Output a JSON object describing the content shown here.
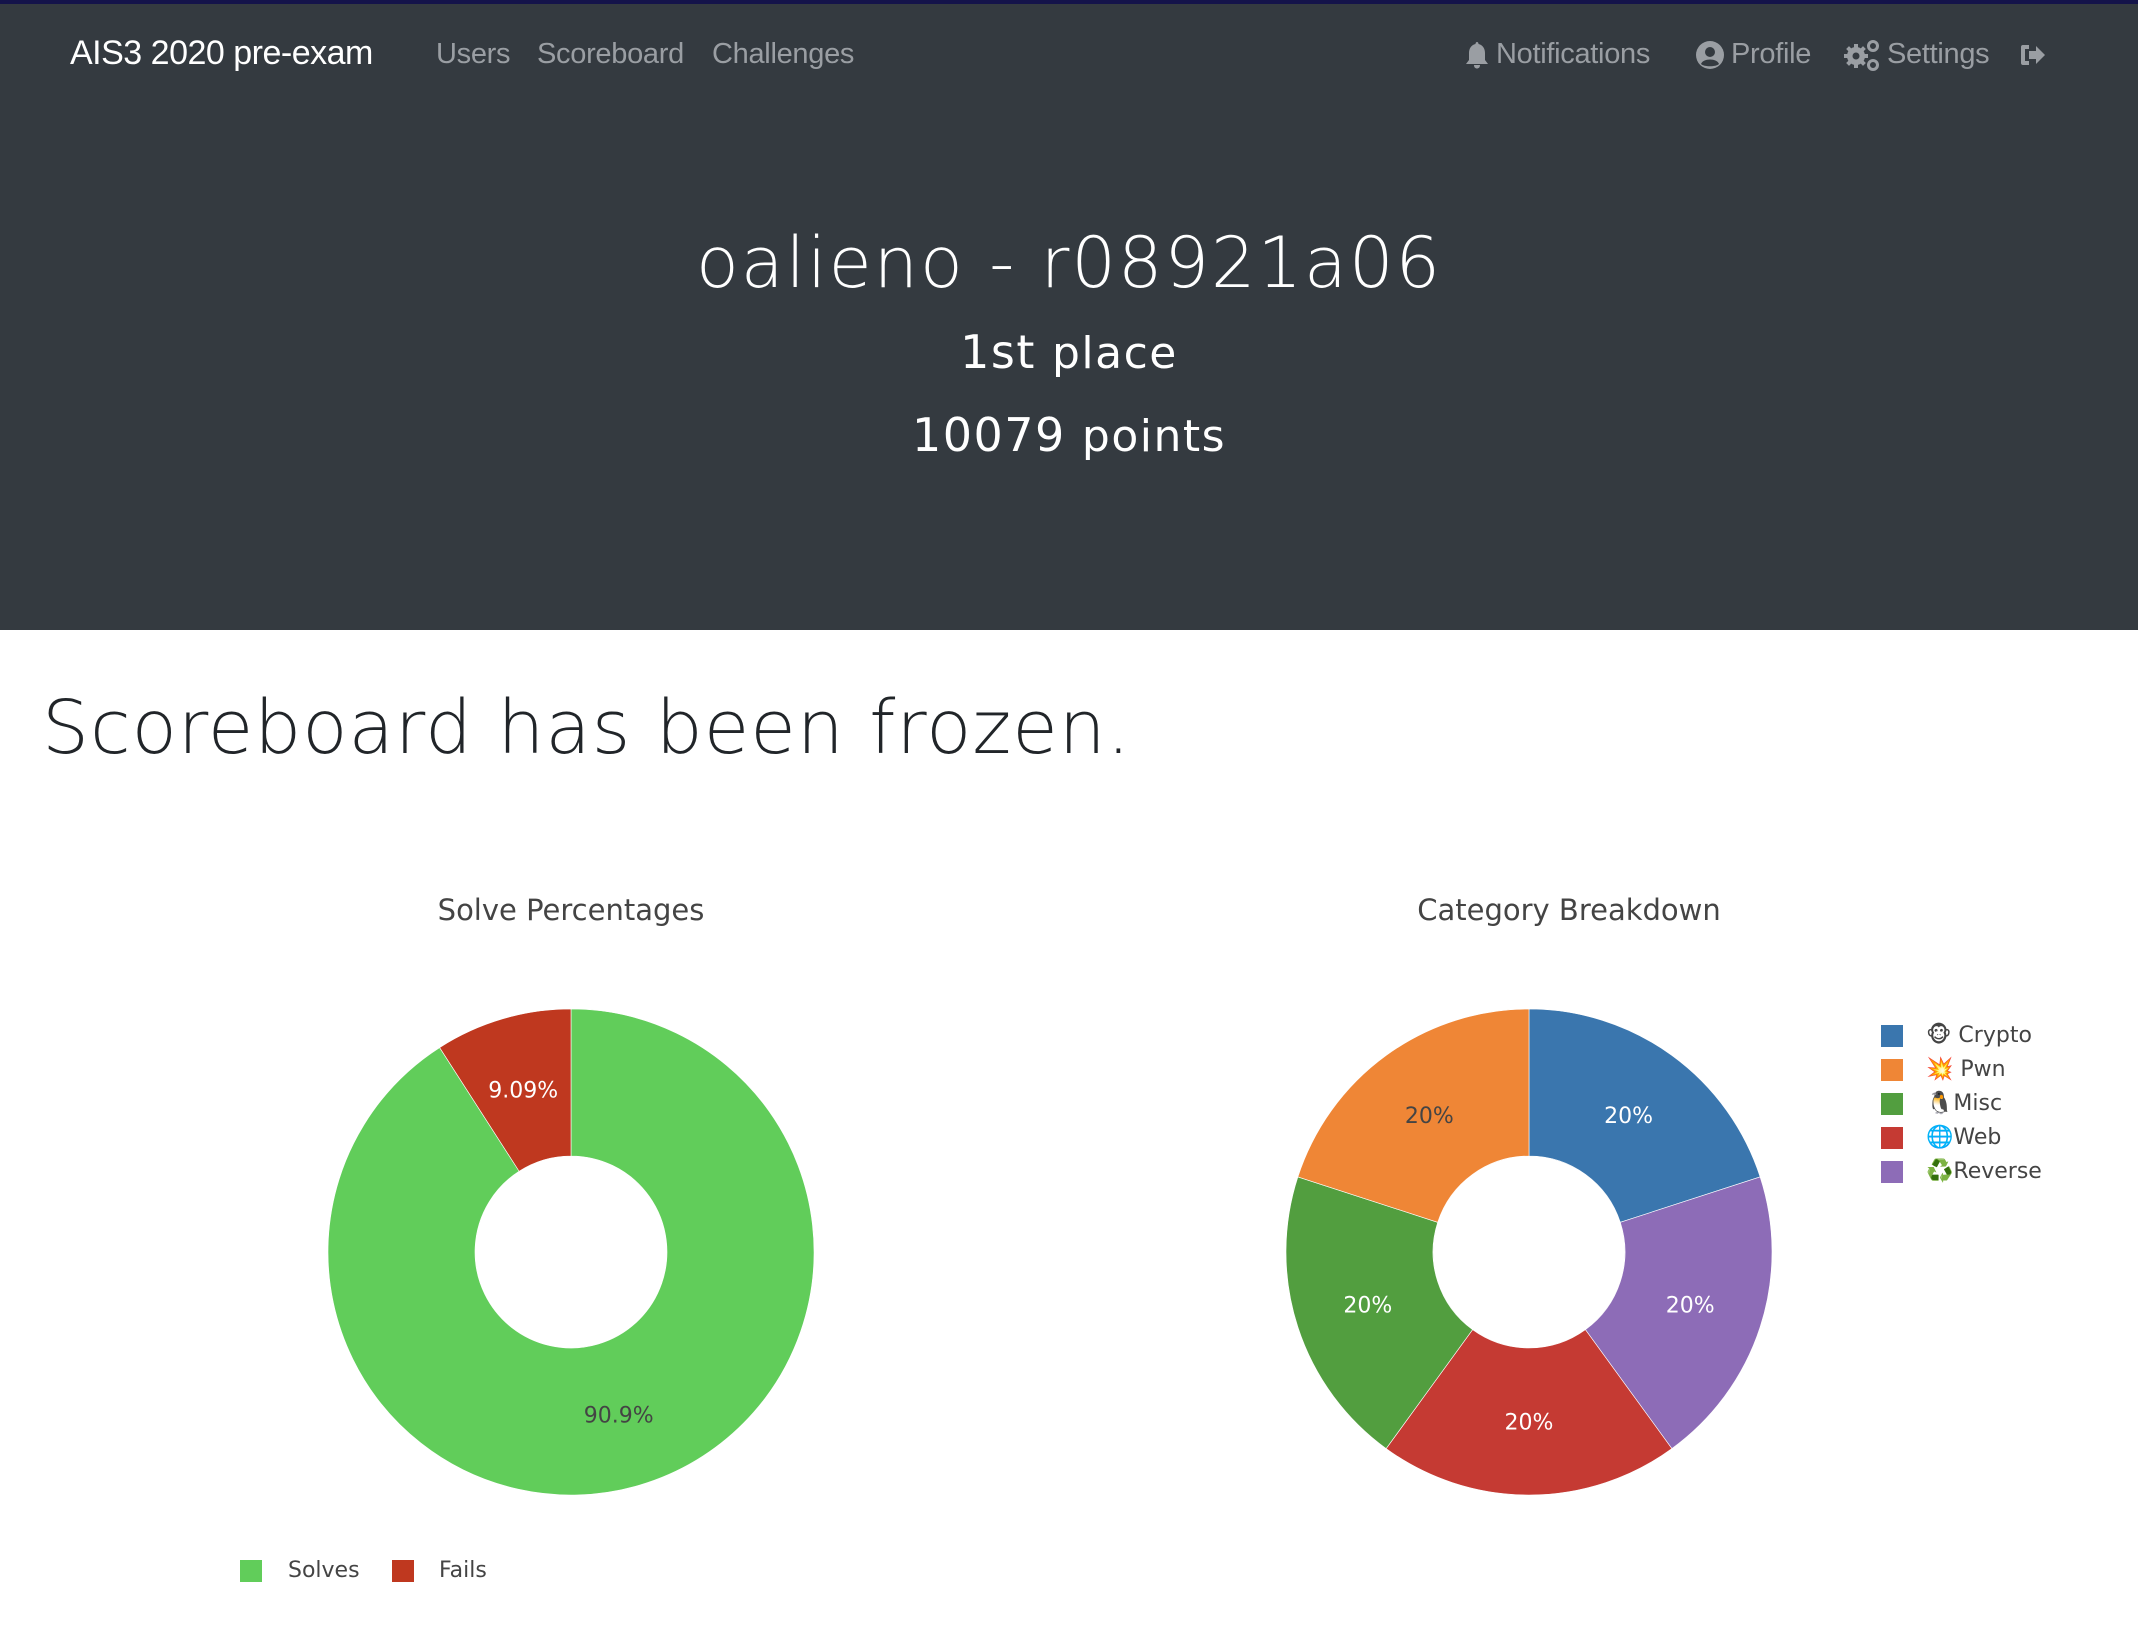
{
  "nav": {
    "brand": "AIS3 2020 pre-exam",
    "left_links": [
      {
        "label": "Users"
      },
      {
        "label": "Scoreboard"
      },
      {
        "label": "Challenges"
      }
    ],
    "right_links": [
      {
        "label": "Notifications",
        "icon": "bell-icon"
      },
      {
        "label": "Profile",
        "icon": "user-circle-icon"
      },
      {
        "label": "Settings",
        "icon": "cogs-icon"
      },
      {
        "label": "",
        "icon": "logout-icon"
      }
    ]
  },
  "header": {
    "name": "oalieno - r08921a06",
    "place_number": "1st",
    "place_label": "place",
    "points_number": "10079",
    "points_label": "points"
  },
  "notice": "Scoreboard has been frozen.",
  "colors": {
    "header_bg": "#343a40",
    "solves": "#61cd5a",
    "fails": "#bf381f",
    "crypto": "#3a76ae",
    "pwn": "#ef8636",
    "misc": "#529e3f",
    "web": "#c53a33",
    "reverse": "#8d6cb7"
  },
  "chart_data": [
    {
      "type": "pie",
      "hole": true,
      "title": "Solve Percentages",
      "labels": [
        "Solves",
        "Fails"
      ],
      "values": [
        90.9,
        9.09
      ],
      "text_labels": [
        "90.9%",
        "9.09%"
      ],
      "colors": [
        "#61cd5a",
        "#bf381f"
      ],
      "legend": "bottom"
    },
    {
      "type": "pie",
      "hole": true,
      "title": "Category Breakdown",
      "labels": [
        "🐵 Crypto",
        "💥 Pwn",
        "🐧Misc",
        "🌐Web",
        "♻️Reverse"
      ],
      "values": [
        20,
        20,
        20,
        20,
        20
      ],
      "text_labels": [
        "20%",
        "20%",
        "20%",
        "20%",
        "20%"
      ],
      "colors": [
        "#3a76ae",
        "#ef8636",
        "#529e3f",
        "#c53a33",
        "#8d6cb7"
      ],
      "clockwise_order_from_top": [
        "🐵 Crypto",
        "♻️Reverse",
        "🌐Web",
        "🐧Misc",
        "💥 Pwn"
      ],
      "legend": "right"
    }
  ]
}
